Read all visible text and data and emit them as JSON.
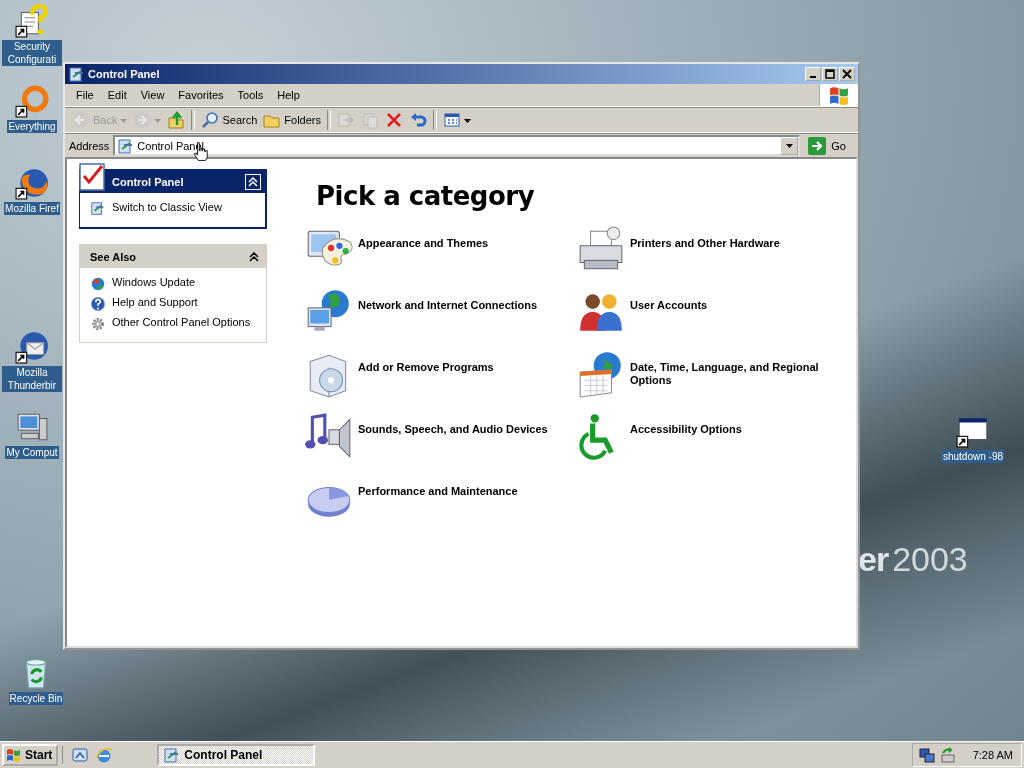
{
  "desktop": {
    "icons": [
      {
        "kind": "security",
        "label": "Security Configurati"
      },
      {
        "kind": "everything",
        "label": "Everything"
      },
      {
        "kind": "firefox",
        "label": "Mozilla Firef"
      },
      {
        "kind": "thunderbird",
        "label": "Mozilla Thunderbir"
      },
      {
        "kind": "computer",
        "label": "My Comput"
      },
      {
        "kind": "recycle",
        "label": "Recycle Bin"
      },
      {
        "kind": "program",
        "label": "shutdown -98"
      }
    ],
    "wallpaper_text": {
      "brand": "er",
      "year": "2003"
    }
  },
  "window": {
    "title": "Control Panel",
    "menu": [
      "File",
      "Edit",
      "View",
      "Favorites",
      "Tools",
      "Help"
    ],
    "toolbar": [
      {
        "kind": "back",
        "label": "Back",
        "disabled": true,
        "dropdown": true
      },
      {
        "kind": "forward",
        "disabled": true,
        "dropdown": true
      },
      {
        "kind": "up",
        "disabled": false
      },
      {
        "kind": "separator"
      },
      {
        "kind": "search",
        "label": "Search",
        "disabled": false
      },
      {
        "kind": "folders",
        "label": "Folders",
        "disabled": false
      },
      {
        "kind": "separator"
      },
      {
        "kind": "move",
        "disabled": true
      },
      {
        "kind": "copy",
        "disabled": true
      },
      {
        "kind": "delete",
        "disabled": false
      },
      {
        "kind": "undo",
        "disabled": false
      },
      {
        "kind": "separator"
      },
      {
        "kind": "views",
        "disabled": false,
        "dropdown": true
      }
    ],
    "address": {
      "label": "Address",
      "value": "Control Panel",
      "go": "Go"
    },
    "task_pane": {
      "panels": [
        {
          "kind": "primary",
          "title": "Control Panel",
          "expanded": true,
          "links": [
            {
              "kind": "classic",
              "label": "Switch to Classic View"
            }
          ]
        },
        {
          "kind": "secondary",
          "title": "See Also",
          "expanded": true,
          "links": [
            {
              "kind": "update",
              "label": "Windows Update"
            },
            {
              "kind": "help",
              "label": "Help and Support"
            },
            {
              "kind": "gear",
              "label": "Other Control Panel Options"
            }
          ]
        }
      ]
    },
    "heading": "Pick a category",
    "categories": [
      {
        "kind": "appearance",
        "label": "Appearance and Themes"
      },
      {
        "kind": "printers",
        "label": "Printers and Other Hardware"
      },
      {
        "kind": "network",
        "label": "Network and Internet Connections"
      },
      {
        "kind": "users",
        "label": "User Accounts"
      },
      {
        "kind": "addremove",
        "label": "Add or Remove Programs"
      },
      {
        "kind": "datetime",
        "label": "Date, Time, Language, and Regional Options"
      },
      {
        "kind": "sounds",
        "label": "Sounds, Speech, and Audio Devices"
      },
      {
        "kind": "accessibility",
        "label": "Accessibility Options"
      },
      {
        "kind": "performance",
        "label": "Performance and Maintenance"
      }
    ]
  },
  "taskbar": {
    "start": "Start",
    "quick_launch": [
      {
        "kind": "desktop"
      },
      {
        "kind": "browser"
      }
    ],
    "tasks": [
      {
        "label": "Control Panel",
        "selected": true
      }
    ],
    "tray": [
      {
        "kind": "network"
      },
      {
        "kind": "install"
      }
    ],
    "clock": "7:28 AM"
  }
}
